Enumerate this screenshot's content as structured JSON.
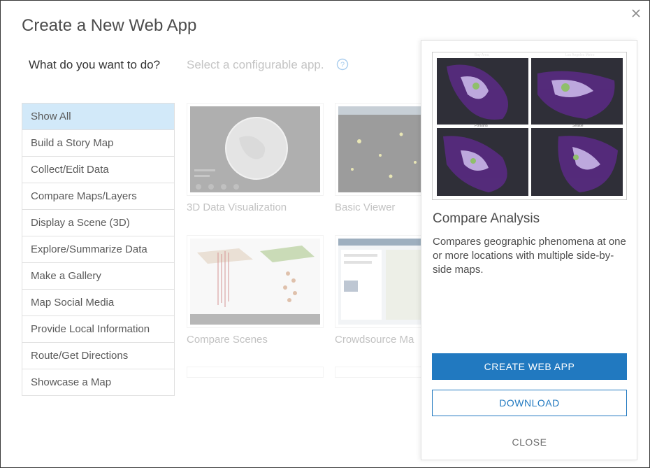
{
  "dialog": {
    "title": "Create a New Web App",
    "close_icon": "close-icon"
  },
  "sidebar": {
    "question": "What do you want to do?",
    "items": [
      {
        "label": "Show All",
        "active": true
      },
      {
        "label": "Build a Story Map"
      },
      {
        "label": "Collect/Edit Data"
      },
      {
        "label": "Compare Maps/Layers"
      },
      {
        "label": "Display a Scene (3D)"
      },
      {
        "label": "Explore/Summarize Data"
      },
      {
        "label": "Make a Gallery"
      },
      {
        "label": "Map Social Media"
      },
      {
        "label": "Provide Local Information"
      },
      {
        "label": "Route/Get Directions"
      },
      {
        "label": "Showcase a Map"
      }
    ]
  },
  "gallery": {
    "prompt": "Select a configurable app.",
    "help_icon": "help-icon",
    "apps": [
      {
        "label": "3D Data Visualization"
      },
      {
        "label": "Basic Viewer"
      },
      {
        "label": "Compare Scenes"
      },
      {
        "label": "Crowdsource Ma"
      }
    ]
  },
  "detail": {
    "title": "Compare Analysis",
    "description": "Compares geographic phenomena at one or more locations with multiple side-by-side maps.",
    "preview_labels": [
      "Bay Area",
      "Los Angeles Metro",
      "Portland",
      "Seattle"
    ],
    "create_label": "CREATE WEB APP",
    "download_label": "DOWNLOAD",
    "close_label": "CLOSE"
  },
  "colors": {
    "accent": "#2179c0",
    "selected_bg": "#d2e9f9",
    "map_purple": "#5b2a86"
  }
}
